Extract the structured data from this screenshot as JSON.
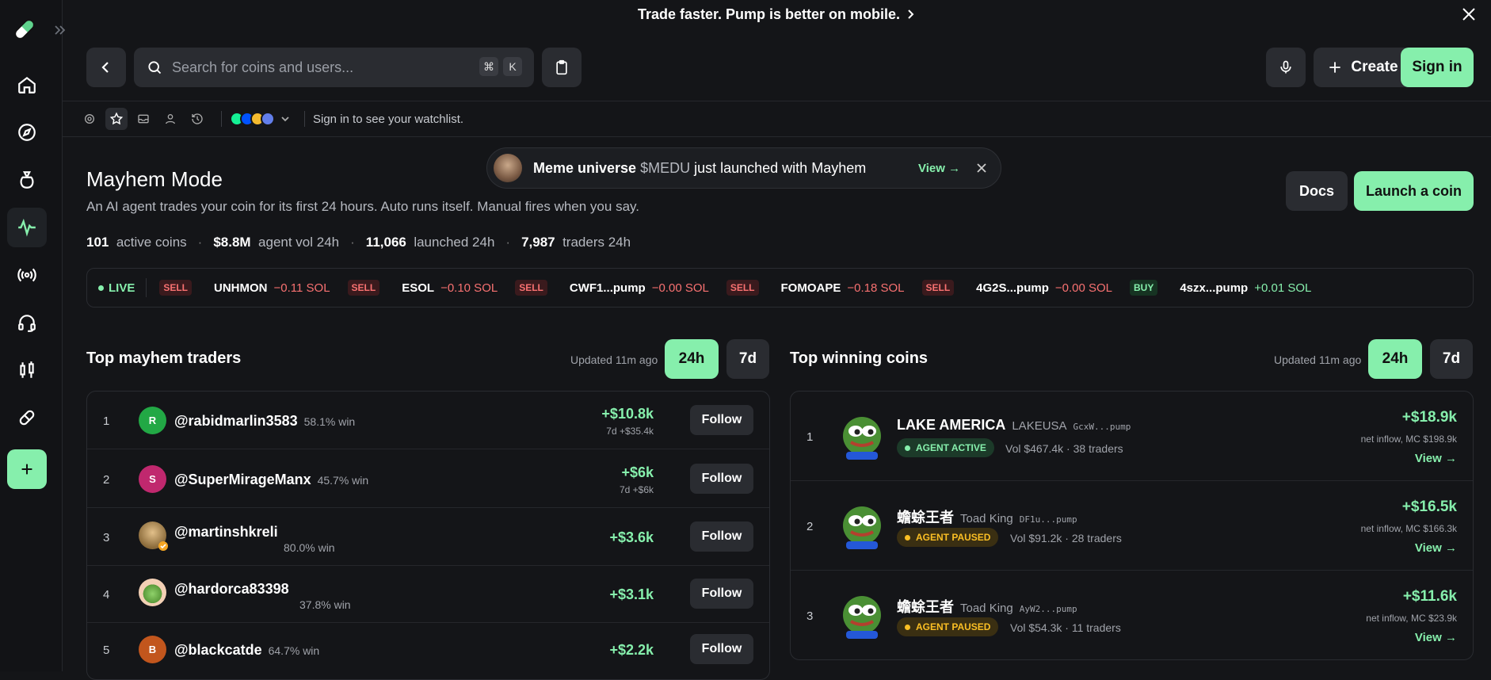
{
  "banner": {
    "text": "Trade faster. Pump is better on mobile."
  },
  "search": {
    "placeholder": "Search for coins and users...",
    "kbd1": "⌘",
    "kbd2": "K"
  },
  "header": {
    "create_label": "Create",
    "signin_label": "Sign in"
  },
  "subbar": {
    "watch_text": "Sign in to see your watchlist."
  },
  "mayhem": {
    "title": "Mayhem Mode",
    "description": "An AI agent trades your coin for its first 24 hours. Auto runs itself. Manual fires when you say.",
    "stats": [
      {
        "value": "101",
        "label": "active coins"
      },
      {
        "value": "$8.8M",
        "label": "agent vol 24h"
      },
      {
        "value": "11,066",
        "label": "launched 24h"
      },
      {
        "value": "7,987",
        "label": "traders 24h"
      }
    ],
    "docs_label": "Docs",
    "launch_label": "Launch a coin"
  },
  "toast": {
    "name": "Meme universe",
    "ticker": "$MEDU",
    "text": "just launched with Mayhem",
    "view": "View →"
  },
  "ticker": {
    "live": "LIVE",
    "items": [
      {
        "side": "SELL",
        "symbol": "UNHMON",
        "amount": "−0.11 SOL"
      },
      {
        "side": "SELL",
        "symbol": "ESOL",
        "amount": "−0.10 SOL"
      },
      {
        "side": "SELL",
        "symbol": "CWF1...pump",
        "amount": "−0.00 SOL"
      },
      {
        "side": "SELL",
        "symbol": "FOMOAPE",
        "amount": "−0.18 SOL"
      },
      {
        "side": "SELL",
        "symbol": "4G2S...pump",
        "amount": "−0.00 SOL"
      },
      {
        "side": "BUY",
        "symbol": "4szx...pump",
        "amount": "+0.01 SOL"
      }
    ]
  },
  "traders": {
    "title": "Top mayhem traders",
    "updated": "Updated 11m ago",
    "range_on": "24h",
    "range_off": "7d",
    "rows": [
      {
        "rank": "1",
        "initial": "R",
        "color": "#22a845",
        "name": "@rabidmarlin3583",
        "win": "58.1% win",
        "pnl": "+$10.8k",
        "sub": "7d +$35.4k",
        "follow": "Follow"
      },
      {
        "rank": "2",
        "initial": "S",
        "color": "#c0286e",
        "name": "@SuperMirageManx",
        "win": "45.7% win",
        "pnl": "+$6k",
        "sub": "7d +$6k",
        "follow": "Follow"
      },
      {
        "rank": "3",
        "initial": "",
        "color": "#b88c3a",
        "name": "@martinshkreli",
        "win": "80.0% win",
        "pnl": "+$3.6k",
        "sub": "",
        "follow": "Follow"
      },
      {
        "rank": "4",
        "initial": "",
        "color": "#f0c6a0",
        "name": "@hardorca83398",
        "win": "37.8% win",
        "pnl": "+$3.1k",
        "sub": "",
        "follow": "Follow"
      },
      {
        "rank": "5",
        "initial": "B",
        "color": "#c2561d",
        "name": "@blackcatde",
        "win": "64.7% win",
        "pnl": "+$2.2k",
        "sub": "",
        "follow": "Follow"
      }
    ]
  },
  "coins": {
    "title": "Top winning coins",
    "updated": "Updated 11m ago",
    "range_on": "24h",
    "range_off": "7d",
    "rows": [
      {
        "rank": "1",
        "name": "LAKE AMERICA",
        "ticker": "LAKEUSA",
        "addr": "GcxW...pump",
        "status": "AGENT ACTIVE",
        "vol": "Vol $467.4k · 38 traders",
        "inflow": "+$18.9k",
        "mc": "net inflow, MC $198.9k",
        "view": "View →"
      },
      {
        "rank": "2",
        "name": "蟾蜍王者",
        "ticker": "Toad King",
        "addr": "DF1u...pump",
        "status": "AGENT PAUSED",
        "vol": "Vol $91.2k · 28 traders",
        "inflow": "+$16.5k",
        "mc": "net inflow, MC $166.3k",
        "view": "View →"
      },
      {
        "rank": "3",
        "name": "蟾蜍王者",
        "ticker": "Toad King",
        "addr": "AyW2...pump",
        "status": "AGENT PAUSED",
        "vol": "Vol $54.3k · 11 traders",
        "inflow": "+$11.6k",
        "mc": "net inflow, MC $23.9k",
        "view": "View →"
      }
    ]
  },
  "colors": {
    "accent": "#86efac",
    "negative": "#f87171",
    "paused": "#fbbf24",
    "background": "#141518"
  }
}
